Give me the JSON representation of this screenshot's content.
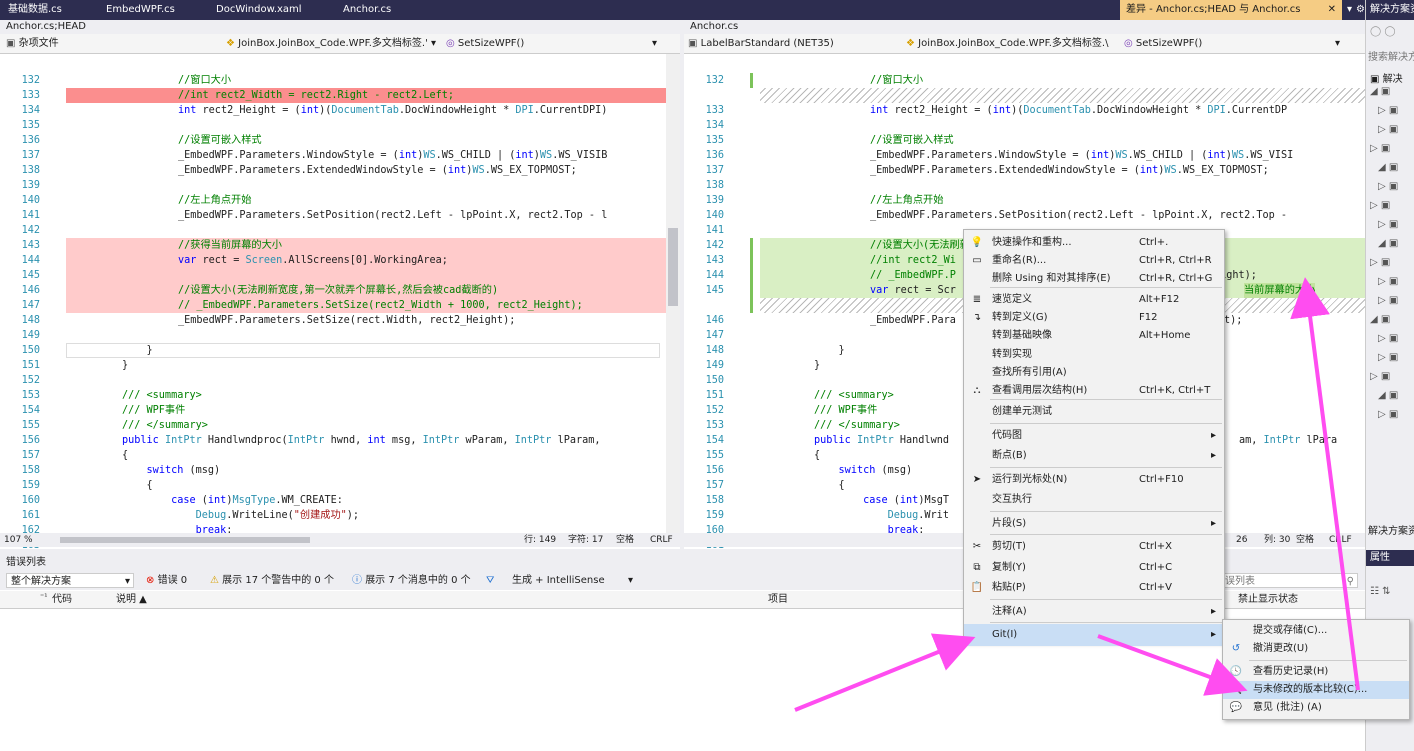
{
  "tabs": [
    "基础数据.cs",
    "EmbedWPF.cs",
    "DocWindow.xaml",
    "Anchor.cs"
  ],
  "diff_tab": {
    "label": "差异 - Anchor.cs;HEAD 与 Anchor.cs",
    "pin": "⇲",
    "close": "✕"
  },
  "left": {
    "title": "Anchor.cs;HEAD",
    "nav1": "杂项文件",
    "nav2": "JoinBox.JoinBox_Code.WPF.多文档标签.'",
    "nav3": "SetSizeWPF()",
    "lines": [
      {
        "n": "132",
        "t": "//窗口大小",
        "c": "cm"
      },
      {
        "n": "133",
        "t": "//int rect2_Width = rect2.Right - rect2.Left;",
        "c": "cm"
      },
      {
        "n": "134",
        "t": "int rect2_Height = (int)(DocumentTab.DocWindowHeight * DPI.CurrentDPI)",
        "c": ""
      },
      {
        "n": "135",
        "t": "",
        "c": ""
      },
      {
        "n": "136",
        "t": "//设置可嵌入样式",
        "c": "cm"
      },
      {
        "n": "137",
        "t": "_EmbedWPF.Parameters.WindowStyle = (int)WS.WS_CHILD | (int)WS.WS_VISIB",
        "c": ""
      },
      {
        "n": "138",
        "t": "_EmbedWPF.Parameters.ExtendedWindowStyle = (int)WS.WS_EX_TOPMOST;",
        "c": ""
      },
      {
        "n": "139",
        "t": "",
        "c": ""
      },
      {
        "n": "140",
        "t": "//左上角点开始",
        "c": "cm"
      },
      {
        "n": "141",
        "t": "_EmbedWPF.Parameters.SetPosition(rect2.Left - lpPoint.X, rect2.Top - l",
        "c": ""
      },
      {
        "n": "142",
        "t": "",
        "c": ""
      },
      {
        "n": "143",
        "t": "//获得当前屏幕的大小",
        "c": "cm"
      },
      {
        "n": "144",
        "t": "var rect = Screen.AllScreens[0].WorkingArea;",
        "c": ""
      },
      {
        "n": "145",
        "t": "",
        "c": ""
      },
      {
        "n": "146",
        "t": "//设置大小(无法刷新宽度,第一次就弄个屏幕长,然后会被cad截断的)",
        "c": "cm"
      },
      {
        "n": "147",
        "t": "// _EmbedWPF.Parameters.SetSize(rect2_Width + 1000, rect2_Height);",
        "c": "cm"
      },
      {
        "n": "148",
        "t": "_EmbedWPF.Parameters.SetSize(rect.Width, rect2_Height);",
        "c": ""
      },
      {
        "n": "149",
        "t": "",
        "c": ""
      },
      {
        "n": "150",
        "t": "    }",
        "c": ""
      },
      {
        "n": "151",
        "t": "}",
        "c": ""
      },
      {
        "n": "152",
        "t": "",
        "c": ""
      },
      {
        "n": "153",
        "t": "/// <summary>",
        "c": "cm"
      },
      {
        "n": "154",
        "t": "/// WPF事件",
        "c": "cm"
      },
      {
        "n": "155",
        "t": "/// </summary>",
        "c": "cm"
      },
      {
        "n": "156",
        "t": "public IntPtr Handlwndproc(IntPtr hwnd, int msg, IntPtr wParam, IntPtr lParam,",
        "c": ""
      },
      {
        "n": "157",
        "t": "{",
        "c": ""
      },
      {
        "n": "158",
        "t": "    switch (msg)",
        "c": ""
      },
      {
        "n": "159",
        "t": "    {",
        "c": ""
      },
      {
        "n": "160",
        "t": "        case (int)MsgType.WM_CREATE:",
        "c": ""
      },
      {
        "n": "161",
        "t": "            Debug.WriteLine(\"创建成功\");",
        "c": ""
      },
      {
        "n": "162",
        "t": "            break;",
        "c": ""
      },
      {
        "n": "163",
        "t": "",
        "c": ""
      }
    ],
    "status": {
      "zoom": "107 %",
      "line": "行: 149",
      "char": "字符: 17",
      "space": "空格",
      "crlf": "CRLF"
    }
  },
  "right": {
    "title": "Anchor.cs",
    "nav1": "LabelBarStandard (NET35)",
    "nav2": "JoinBox.JoinBox_Code.WPF.多文档标签.\\",
    "nav3": "SetSizeWPF()",
    "lines": [
      {
        "n": "132",
        "t": "//窗口大小",
        "c": "cm"
      },
      {
        "n": "",
        "t": "",
        "c": "hatch"
      },
      {
        "n": "133",
        "t": "int rect2_Height = (int)(DocumentTab.DocWindowHeight * DPI.CurrentDP",
        "c": ""
      },
      {
        "n": "134",
        "t": "",
        "c": ""
      },
      {
        "n": "135",
        "t": "//设置可嵌入样式",
        "c": "cm"
      },
      {
        "n": "136",
        "t": "_EmbedWPF.Parameters.WindowStyle = (int)WS.WS_CHILD | (int)WS.WS_VISI",
        "c": ""
      },
      {
        "n": "137",
        "t": "_EmbedWPF.Parameters.ExtendedWindowStyle = (int)WS.WS_EX_TOPMOST;",
        "c": ""
      },
      {
        "n": "138",
        "t": "",
        "c": ""
      },
      {
        "n": "139",
        "t": "//左上角点开始",
        "c": "cm"
      },
      {
        "n": "140",
        "t": "_EmbedWPF.Parameters.SetPosition(rect2.Left - lpPoint.X, rect2.Top -",
        "c": ""
      },
      {
        "n": "141",
        "t": "",
        "c": ""
      },
      {
        "n": "142",
        "t": "//设置大小(无法刷新宽度,第一次就弄个屏幕长,然后会被cad主窗口截断的)",
        "c": "cm"
      },
      {
        "n": "143",
        "t": "//int rect2_Wi",
        "c": "cm"
      },
      {
        "n": "144",
        "t": "// _EmbedWPF.P",
        "c": "cm"
      },
      {
        "n": "145",
        "t": "var rect = Scr",
        "c": ""
      },
      {
        "n": "",
        "t": "",
        "c": "hatch"
      },
      {
        "n": "146",
        "t": "_EmbedWPF.Para",
        "c": ""
      },
      {
        "n": "147",
        "t": "",
        "c": ""
      },
      {
        "n": "148",
        "t": "    }",
        "c": ""
      },
      {
        "n": "149",
        "t": "}",
        "c": ""
      },
      {
        "n": "150",
        "t": "",
        "c": ""
      },
      {
        "n": "151",
        "t": "/// <summary>",
        "c": "cm"
      },
      {
        "n": "152",
        "t": "/// WPF事件",
        "c": "cm"
      },
      {
        "n": "153",
        "t": "/// </summary>",
        "c": "cm"
      },
      {
        "n": "154",
        "t": "public IntPtr Handlwnd",
        "c": ""
      },
      {
        "n": "155",
        "t": "{",
        "c": ""
      },
      {
        "n": "156",
        "t": "    switch (msg)",
        "c": ""
      },
      {
        "n": "157",
        "t": "    {",
        "c": ""
      },
      {
        "n": "158",
        "t": "        case (int)MsgT",
        "c": ""
      },
      {
        "n": "159",
        "t": "            Debug.Writ",
        "c": ""
      },
      {
        "n": "160",
        "t": "            break;",
        "c": ""
      },
      {
        "n": "161",
        "t": "",
        "c": ""
      }
    ],
    "tails": {
      "t144": "eight);",
      "t145": "当前屏幕的大小",
      "t146": "t);",
      "t154": "am, IntPtr lPara"
    },
    "status": {
      "line": "26",
      "col": "列: 30",
      "space": "空格",
      "crlf": "CRLF"
    }
  },
  "errors": {
    "title": "错误列表",
    "scope": "整个解决方案",
    "err": "错误 0",
    "warn": "展示 17 个警告中的 0 个",
    "msg": "展示 7 个消息中的 0 个",
    "build": "生成 + IntelliSense",
    "search": "误列表",
    "cols": [
      "代码",
      "说明 ▲",
      "项目",
      "禁止显示状态"
    ]
  },
  "solution": {
    "title": "解决方案资",
    "search": "搜索解决方",
    "root": "解决",
    "props": "属性",
    "bottom_title": "解决方案资"
  },
  "menu": [
    {
      "icon": "💡",
      "label": "快速操作和重构...",
      "key": "Ctrl+."
    },
    {
      "icon": "▭",
      "label": "重命名(R)...",
      "key": "Ctrl+R, Ctrl+R"
    },
    {
      "icon": "",
      "label": "删除 Using 和对其排序(E)",
      "key": "Ctrl+R, Ctrl+G"
    },
    {
      "icon": "≣",
      "label": "速览定义",
      "key": "Alt+F12"
    },
    {
      "icon": "↴",
      "label": "转到定义(G)",
      "key": "F12"
    },
    {
      "icon": "",
      "label": "转到基础映像",
      "key": "Alt+Home"
    },
    {
      "icon": "",
      "label": "转到实现",
      "key": ""
    },
    {
      "icon": "",
      "label": "查找所有引用(A)",
      "key": ""
    },
    {
      "icon": "⛬",
      "label": "查看调用层次结构(H)",
      "key": "Ctrl+K, Ctrl+T"
    },
    {
      "icon": "",
      "label": "创建单元测试",
      "key": ""
    },
    {
      "icon": "",
      "label": "代码图",
      "key": "",
      "sub": true
    },
    {
      "icon": "",
      "label": "断点(B)",
      "key": "",
      "sub": true
    },
    {
      "icon": "➤",
      "label": "运行到光标处(N)",
      "key": "Ctrl+F10"
    },
    {
      "icon": "",
      "label": "交互执行",
      "key": ""
    },
    {
      "icon": "",
      "label": "片段(S)",
      "key": "",
      "sub": true
    },
    {
      "icon": "✂",
      "label": "剪切(T)",
      "key": "Ctrl+X"
    },
    {
      "icon": "⧉",
      "label": "复制(Y)",
      "key": "Ctrl+C"
    },
    {
      "icon": "📋",
      "label": "粘贴(P)",
      "key": "Ctrl+V"
    },
    {
      "icon": "",
      "label": "注释(A)",
      "key": "",
      "sub": true
    },
    {
      "icon": "",
      "label": "Git(I)",
      "key": "",
      "sub": true
    }
  ],
  "submenu": [
    {
      "icon": "",
      "label": "提交或存储(C)..."
    },
    {
      "icon": "↺",
      "label": "撤消更改(U)"
    },
    {
      "icon": "🕓",
      "label": "查看历史记录(H)"
    },
    {
      "icon": "🔍",
      "label": "与未修改的版本比较(C)..."
    },
    {
      "icon": "💬",
      "label": "意见 (批注) (A)"
    }
  ],
  "colors": {
    "accent": "#ff4df0",
    "tabbar": "#2d2d50"
  }
}
